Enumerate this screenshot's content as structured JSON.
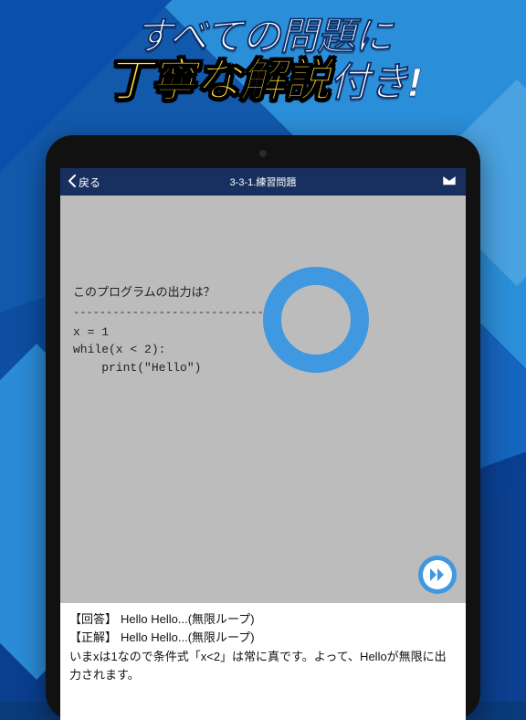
{
  "promo": {
    "line1": "すべての問題に",
    "line2_accent": "丁寧な解説",
    "line2_suffix": "付き!"
  },
  "app": {
    "back_label": "戻る",
    "screen_title": "3-3-1.練習問題"
  },
  "question": {
    "prompt": "このプログラムの出力は？",
    "divider": "-------------------------------",
    "code": "x = 1\nwhile(x < 2):\n    print(\"Hello\")"
  },
  "explanation": {
    "answer_label": "【回答】",
    "answer_value": "Hello Hello...(無限ループ)",
    "correct_label": "【正解】",
    "correct_value": "Hello Hello...(無限ループ)",
    "body": "いまxは1なので条件式「x<2」は常に真です。よって、Helloが無限に出力されます。"
  },
  "colors": {
    "ring": "#3f98e0",
    "header_bg": "#18305f"
  }
}
